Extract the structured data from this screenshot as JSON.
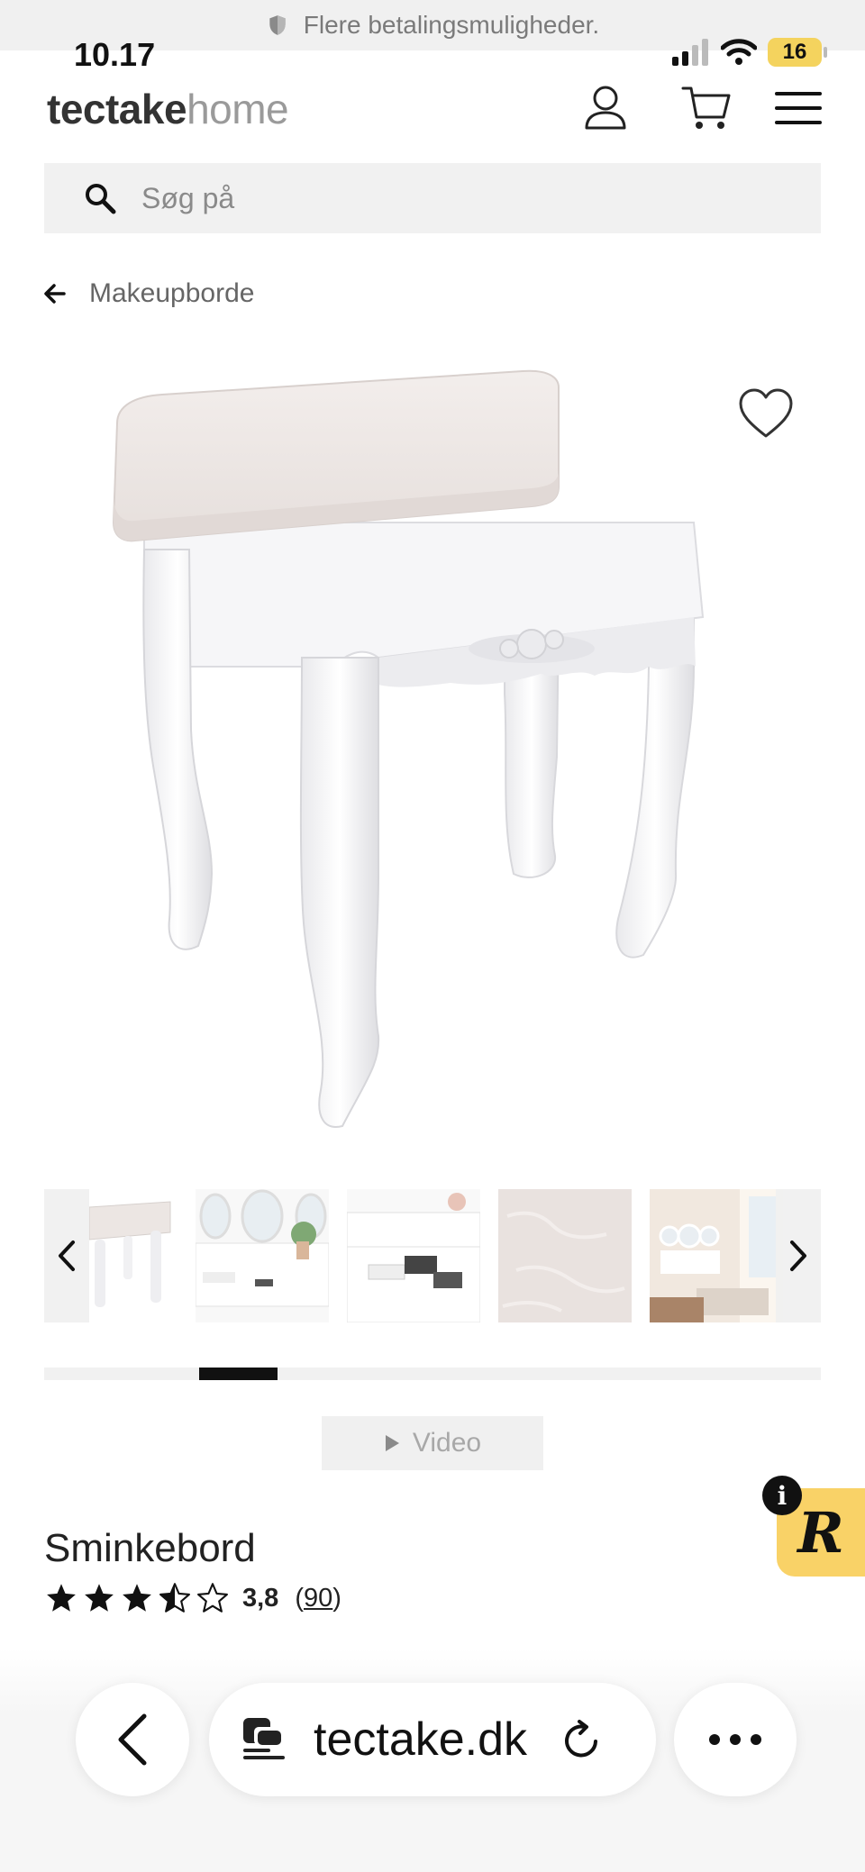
{
  "banner": {
    "text": "Flere betalingsmuligheder."
  },
  "status": {
    "time": "10.17",
    "battery": "16"
  },
  "header": {
    "logo_bold": "tectake",
    "logo_light": "home"
  },
  "search": {
    "placeholder": "Søg på"
  },
  "breadcrumb": {
    "label": "Makeupborde"
  },
  "gallery": {
    "thumbnail_count": 5,
    "progress_start": 0.2,
    "progress_end": 0.3
  },
  "video": {
    "label": "Video"
  },
  "product": {
    "title": "Sminkebord",
    "rating_value": 3.8,
    "rating_text": "3,8",
    "review_count": "90",
    "review_open": "(",
    "review_close": ")"
  },
  "badge": {
    "letter": "R",
    "info": "i"
  },
  "browser": {
    "url": "tectake.dk"
  },
  "colors": {
    "badge": "#f9d267",
    "battery": "#f4d35e",
    "accent": "#111111"
  }
}
